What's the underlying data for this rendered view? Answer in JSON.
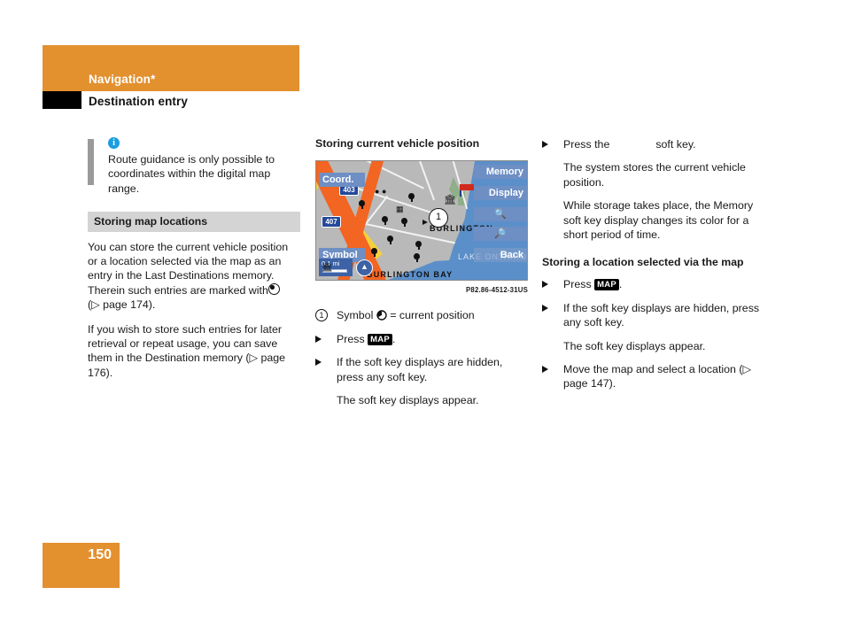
{
  "header": {
    "chapter": "Navigation*",
    "section": "Destination entry"
  },
  "left_column": {
    "info_note": {
      "icon": "info-icon",
      "text": "Route guidance is only possible to coordinates within the digital map range."
    },
    "subsection_bar": "Storing map locations",
    "paragraph_1_part_a": "You can store the current vehicle position or a location selected via the map as an entry in the Last Destinations memory. Therein such entries are marked with",
    "paragraph_1_part_b": "(▷ page 174).",
    "paragraph_2": "If you wish to store such entries for later retrieval or repeat usage, you can save them in the Destination memory (▷ page 176)."
  },
  "middle_column": {
    "subhead": "Storing current vehicle position",
    "figure": {
      "caption": "P82.86-4512-31US",
      "callout_number": "1",
      "softkeys": [
        {
          "label": "Coord.",
          "name": "coord-softkey"
        },
        {
          "label": "Symbol",
          "name": "symbol-softkey"
        },
        {
          "label": "Memory",
          "name": "memory-softkey"
        },
        {
          "label": "Display",
          "name": "display-softkey"
        },
        {
          "label": "Back",
          "name": "back-softkey"
        }
      ],
      "zoom_in_icon": "zoom-in-icon",
      "zoom_out_icon": "zoom-out-icon",
      "shields": [
        "403",
        "407"
      ],
      "map_labels": [
        "BURLINGTON",
        "BURLINGTON BAY",
        "LAKE ONTARIO"
      ],
      "scale": "0.1 mi",
      "compass_icon": "compass-north-icon"
    },
    "legend_item": {
      "number": "1",
      "text_before": "Symbol",
      "text_after": "= current position"
    },
    "steps": [
      {
        "prefix": "Press",
        "key": "MAP",
        "suffix": "."
      },
      {
        "text": "If the soft key displays are hidden, press any soft key."
      }
    ],
    "result": "The soft key displays appear."
  },
  "right_column": {
    "step_press_memory": {
      "prefix": "Press the",
      "missing_graphic": "memory-softkey-graphic",
      "suffix": "soft key."
    },
    "result_1": "The system stores the current vehicle position.",
    "result_2": "While storage takes place, the Memory soft key display changes its color for a short period of time.",
    "subhead": "Storing a location selected via the map",
    "steps": [
      {
        "prefix": "Press",
        "key": "MAP",
        "suffix": "."
      },
      {
        "text": "If the soft key displays are hidden, press any soft key."
      }
    ],
    "result_3": "The soft key displays appear.",
    "step_move_map": "Move the map and select a location (▷ page 147)."
  },
  "footer": {
    "page_number": "150"
  },
  "colors": {
    "accent_orange": "#e3902f",
    "subsection_gray": "#d4d4d4",
    "info_blue": "#1b9ee0",
    "map_water": "#5b8fc9",
    "map_road": "#f26522",
    "softkey_blue": "#6e8fc4"
  }
}
